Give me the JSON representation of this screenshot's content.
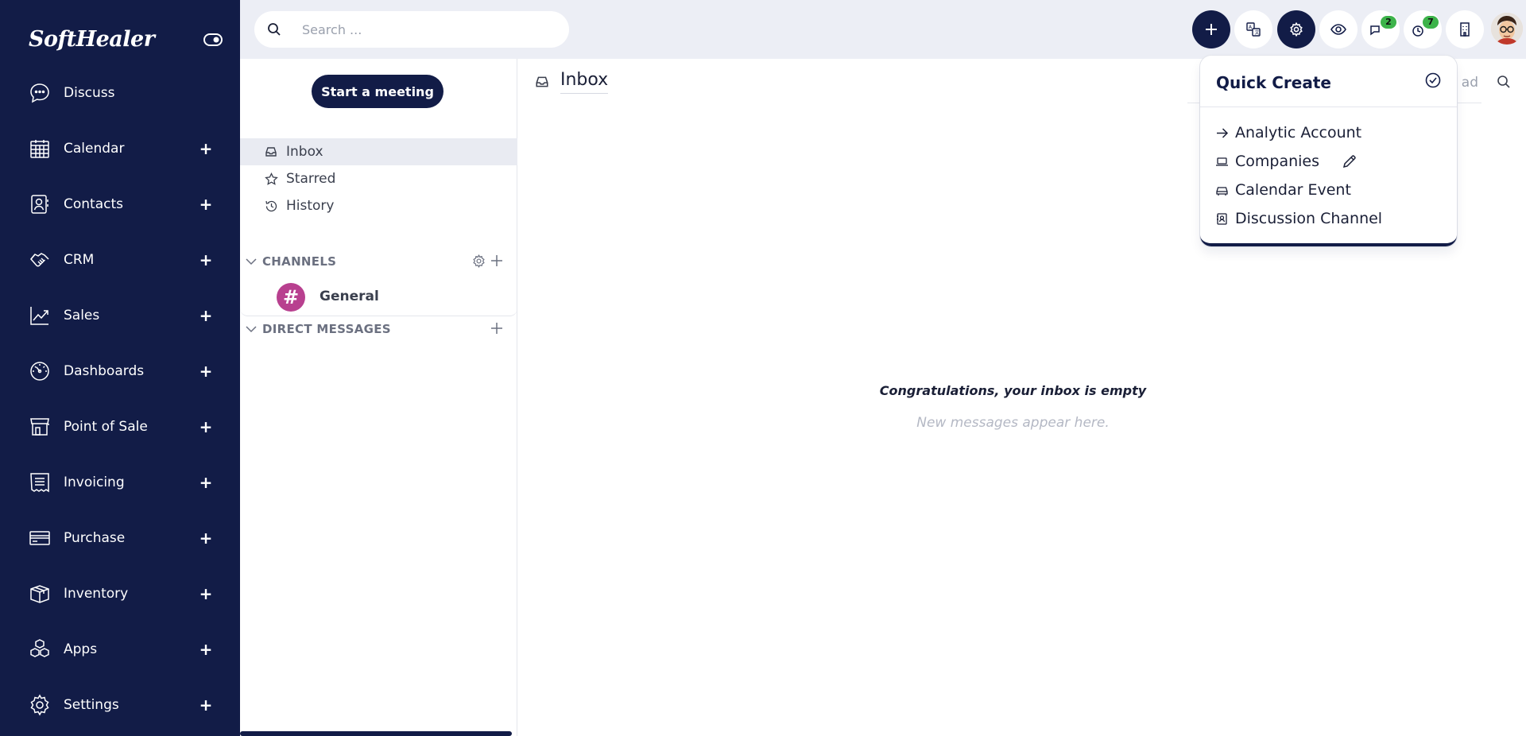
{
  "brand": "SoftHealer",
  "sidebar": {
    "items": [
      {
        "label": "Discuss",
        "icon": "chat-bubble-icon",
        "plus": false
      },
      {
        "label": "Calendar",
        "icon": "calendar-icon",
        "plus": true
      },
      {
        "label": "Contacts",
        "icon": "contact-card-icon",
        "plus": true
      },
      {
        "label": "CRM",
        "icon": "handshake-icon",
        "plus": true
      },
      {
        "label": "Sales",
        "icon": "trend-chart-icon",
        "plus": true
      },
      {
        "label": "Dashboards",
        "icon": "gauge-icon",
        "plus": true
      },
      {
        "label": "Point of Sale",
        "icon": "store-icon",
        "plus": true
      },
      {
        "label": "Invoicing",
        "icon": "receipt-icon",
        "plus": true
      },
      {
        "label": "Purchase",
        "icon": "credit-card-icon",
        "plus": true
      },
      {
        "label": "Inventory",
        "icon": "box-icon",
        "plus": true
      },
      {
        "label": "Apps",
        "icon": "cubes-icon",
        "plus": true
      },
      {
        "label": "Settings",
        "icon": "gear-icon",
        "plus": true
      }
    ],
    "plus_symbol": "+"
  },
  "topbar": {
    "search_placeholder": "Search ...",
    "messages_badge": "2",
    "activities_badge": "7"
  },
  "left_panel": {
    "meeting_button": "Start a meeting",
    "mailboxes": [
      {
        "label": "Inbox",
        "active": true
      },
      {
        "label": "Starred",
        "active": false
      },
      {
        "label": "History",
        "active": false
      }
    ],
    "channels_label": "CHANNELS",
    "channels": [
      {
        "name": "General",
        "avatar_symbol": "#"
      }
    ],
    "direct_messages_label": "DIRECT MESSAGES"
  },
  "main": {
    "title": "Inbox",
    "mark_read_partial": "ad",
    "empty_title": "Congratulations, your inbox is empty",
    "empty_subtitle": "New messages appear here."
  },
  "quick_create": {
    "title": "Quick Create",
    "items": [
      {
        "label": "Analytic Account",
        "icon": "arrow-right-icon"
      },
      {
        "label": "Companies",
        "icon": "laptop-icon"
      },
      {
        "label": "Calendar Event",
        "icon": "car-icon"
      },
      {
        "label": "Discussion Channel",
        "icon": "contact-book-icon"
      }
    ]
  },
  "colors": {
    "sidebar_bg": "#121c47",
    "topbar_bg": "#eceef5",
    "badge_green": "#3db34a",
    "channel_avatar": "#b8408f"
  }
}
